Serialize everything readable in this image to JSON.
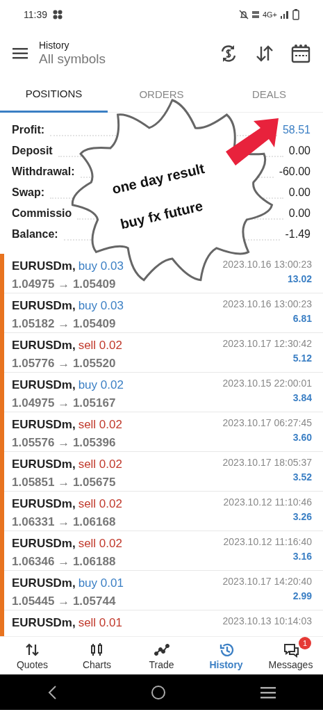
{
  "status_bar": {
    "time": "11:39",
    "network": "4G+"
  },
  "header": {
    "subtitle": "History",
    "title": "All symbols"
  },
  "tabs": [
    {
      "label": "POSITIONS",
      "selected": true
    },
    {
      "label": "ORDERS",
      "selected": false
    },
    {
      "label": "DEALS",
      "selected": false
    }
  ],
  "summary": [
    {
      "label": "Profit:",
      "value": "58.51",
      "highlight": true
    },
    {
      "label": "Deposit",
      "value": "0.00",
      "highlight": false
    },
    {
      "label": "Withdrawal:",
      "value": "-60.00",
      "highlight": false
    },
    {
      "label": "Swap:",
      "value": "0.00",
      "highlight": false
    },
    {
      "label": "Commissio",
      "value": "0.00",
      "highlight": false
    },
    {
      "label": "Balance:",
      "value": "-1.49",
      "highlight": false
    }
  ],
  "callout": {
    "lines": [
      "one day result",
      "buy fx future"
    ]
  },
  "deals": [
    {
      "symbol": "EURUSDm,",
      "type": "buy",
      "volume": "0.03",
      "prices": "1.04975 → 1.05409",
      "time": "2023.10.16 13:00:23",
      "profit": "13.02"
    },
    {
      "symbol": "EURUSDm,",
      "type": "buy",
      "volume": "0.03",
      "prices": "1.05182 → 1.05409",
      "time": "2023.10.16 13:00:23",
      "profit": "6.81"
    },
    {
      "symbol": "EURUSDm,",
      "type": "sell",
      "volume": "0.02",
      "prices": "1.05776 → 1.05520",
      "time": "2023.10.17 12:30:42",
      "profit": "5.12"
    },
    {
      "symbol": "EURUSDm,",
      "type": "buy",
      "volume": "0.02",
      "prices": "1.04975 → 1.05167",
      "time": "2023.10.15 22:00:01",
      "profit": "3.84"
    },
    {
      "symbol": "EURUSDm,",
      "type": "sell",
      "volume": "0.02",
      "prices": "1.05576 → 1.05396",
      "time": "2023.10.17 06:27:45",
      "profit": "3.60"
    },
    {
      "symbol": "EURUSDm,",
      "type": "sell",
      "volume": "0.02",
      "prices": "1.05851 → 1.05675",
      "time": "2023.10.17 18:05:37",
      "profit": "3.52"
    },
    {
      "symbol": "EURUSDm,",
      "type": "sell",
      "volume": "0.02",
      "prices": "1.06331 → 1.06168",
      "time": "2023.10.12 11:10:46",
      "profit": "3.26"
    },
    {
      "symbol": "EURUSDm,",
      "type": "sell",
      "volume": "0.02",
      "prices": "1.06346 → 1.06188",
      "time": "2023.10.12 11:16:40",
      "profit": "3.16"
    },
    {
      "symbol": "EURUSDm,",
      "type": "buy",
      "volume": "0.01",
      "prices": "1.05445 → 1.05744",
      "time": "2023.10.17 14:20:40",
      "profit": "2.99"
    },
    {
      "symbol": "EURUSDm,",
      "type": "sell",
      "volume": "0.01",
      "time": "2023.10.13 10:14:03"
    }
  ],
  "bottom_nav": [
    {
      "label": "Quotes",
      "selected": false
    },
    {
      "label": "Charts",
      "selected": false
    },
    {
      "label": "Trade",
      "selected": false
    },
    {
      "label": "History",
      "selected": true
    },
    {
      "label": "Messages",
      "selected": false,
      "badge": "1"
    }
  ]
}
